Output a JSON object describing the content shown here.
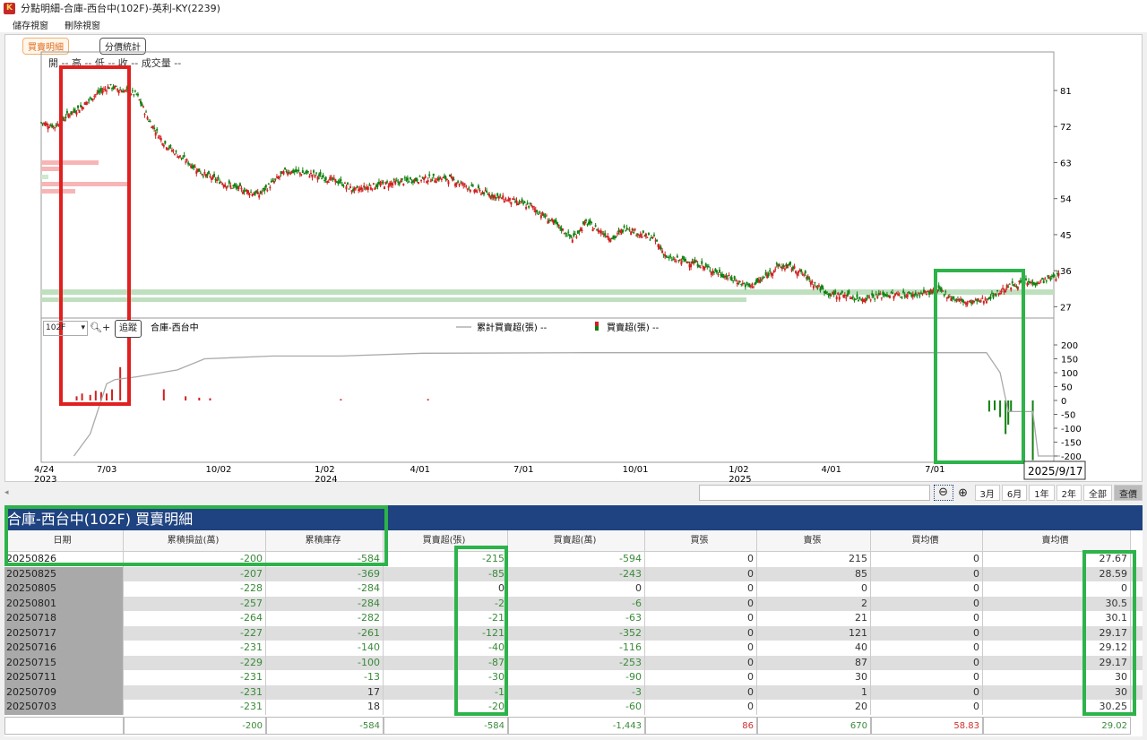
{
  "window": {
    "title": "分點明細-合庫-西台中(102F)-英利-KY(2239)",
    "app_icon": "K"
  },
  "menu": [
    "儲存視窗",
    "刪除視窗"
  ],
  "tabs": [
    "買賣明細",
    "分價統計"
  ],
  "ohlc_label": "開 -- 高 -- 低 -- 收 -- 成交量 --",
  "lower_panel": {
    "broker_select": "102F",
    "track_button": "追蹤",
    "broker_name": "合庫-西台中",
    "legend_line": "累計買賣超(張) --",
    "legend_bar": "買賣超(張) --"
  },
  "tooltip_date": "2025/9/17",
  "nav": {
    "buttons": [
      "3月",
      "6月",
      "1年",
      "2年",
      "全部",
      "查價"
    ]
  },
  "colors": {
    "up": "#d02020",
    "down": "#108010",
    "header": "#1e4380",
    "annot_red": "#e02020",
    "annot_green": "#2db34a"
  },
  "chart_data": [
    {
      "type": "candlestick",
      "title": "英利-KY(2239) 價格",
      "y_ticks": [
        81,
        72,
        63,
        54,
        45,
        36,
        27
      ],
      "ylim": [
        23,
        87
      ],
      "x_ticks": [
        {
          "label": "4/24",
          "year": "2023"
        },
        {
          "label": "7/03"
        },
        {
          "label": "10/02"
        },
        {
          "label": "1/02",
          "year": "2024"
        },
        {
          "label": "4/01"
        },
        {
          "label": "7/01"
        },
        {
          "label": "10/01"
        },
        {
          "label": "1/02",
          "year": "2025"
        },
        {
          "label": "4/01"
        },
        {
          "label": "7/01"
        }
      ],
      "close_series_month_index": [
        0,
        0.5,
        1,
        1.5,
        2,
        2.5,
        3,
        3.5,
        4,
        4.5,
        5,
        6,
        7,
        8,
        8.5,
        9,
        10,
        11,
        11.5,
        12,
        13,
        14,
        15,
        16,
        17,
        18,
        19,
        19.5,
        20,
        20.5,
        21,
        21.5,
        22,
        22.5,
        23,
        24,
        25,
        26,
        26.5,
        27,
        27.5,
        28,
        28.5,
        29,
        29.5,
        30,
        31,
        32,
        33,
        33.5,
        34,
        34.5,
        35,
        35.5,
        36,
        36.5,
        37,
        37.4
      ],
      "close": [
        73,
        72,
        75,
        77,
        80,
        82,
        81,
        80,
        73,
        68,
        65,
        60,
        57,
        55,
        58,
        61,
        60,
        58,
        56,
        57,
        58,
        59,
        59,
        56,
        54,
        52,
        47,
        44,
        48,
        46,
        44,
        47,
        45,
        44,
        39,
        38,
        35,
        32,
        34,
        37,
        37,
        35,
        32,
        30,
        30,
        29,
        30,
        30,
        31,
        29,
        28,
        28.5,
        30,
        32,
        33,
        33,
        34,
        35
      ]
    },
    {
      "type": "bar+line",
      "series": [
        {
          "name": "累計買賣超(張)",
          "type": "line"
        },
        {
          "name": "買賣超(張)",
          "type": "bar"
        }
      ],
      "y_ticks": [
        200,
        150,
        100,
        50,
        0,
        -50,
        -100,
        -150,
        -200
      ],
      "ylim": [
        -220,
        220
      ],
      "cum_month_index": [
        1.2,
        1.8,
        2.2,
        2.4,
        2.7,
        3.5,
        5,
        6,
        8.5,
        11,
        14,
        20,
        26,
        30,
        34.7,
        35.2,
        35.5,
        36.4,
        36.6,
        37.4
      ],
      "cum": [
        -200,
        -120,
        0,
        60,
        75,
        85,
        110,
        150,
        160,
        160,
        170,
        172,
        172,
        172,
        172,
        100,
        -40,
        -40,
        -200,
        -200
      ],
      "bar_month_index": [
        1.3,
        1.5,
        1.8,
        2.0,
        2.2,
        2.4,
        2.6,
        2.9,
        3.2,
        4.5,
        5.3,
        5.8,
        6.2,
        11,
        14.2,
        34.8,
        35.0,
        35.2,
        35.4,
        35.5,
        35.6,
        36.4
      ],
      "bars": [
        15,
        25,
        20,
        35,
        30,
        25,
        40,
        120,
        20,
        40,
        15,
        10,
        8,
        5,
        5,
        -40,
        -35,
        -60,
        -121,
        -87,
        -40,
        -215
      ]
    }
  ],
  "table": {
    "title": "合庫-西台中(102F) 買賣明細",
    "columns": [
      "日期",
      "累積損益(萬)",
      "累積庫存",
      "買賣超(張)",
      "買賣超(萬)",
      "買張",
      "賣張",
      "買均價",
      "賣均價"
    ],
    "rows": [
      [
        "20250826",
        "-200",
        "-584",
        "-215",
        "-594",
        "0",
        "215",
        "0",
        "27.67"
      ],
      [
        "20250825",
        "-207",
        "-369",
        "-85",
        "-243",
        "0",
        "85",
        "0",
        "28.59"
      ],
      [
        "20250805",
        "-228",
        "-284",
        "0",
        "0",
        "0",
        "0",
        "0",
        "0"
      ],
      [
        "20250801",
        "-257",
        "-284",
        "-2",
        "-6",
        "0",
        "2",
        "0",
        "30.5"
      ],
      [
        "20250718",
        "-264",
        "-282",
        "-21",
        "-63",
        "0",
        "21",
        "0",
        "30.1"
      ],
      [
        "20250717",
        "-227",
        "-261",
        "-121",
        "-352",
        "0",
        "121",
        "0",
        "29.17"
      ],
      [
        "20250716",
        "-231",
        "-140",
        "-40",
        "-116",
        "0",
        "40",
        "0",
        "29.12"
      ],
      [
        "20250715",
        "-229",
        "-100",
        "-87",
        "-253",
        "0",
        "87",
        "0",
        "29.17"
      ],
      [
        "20250711",
        "-231",
        "-13",
        "-30",
        "-90",
        "0",
        "30",
        "0",
        "30"
      ],
      [
        "20250709",
        "-231",
        "17",
        "-1",
        "-3",
        "0",
        "1",
        "0",
        "30"
      ],
      [
        "20250703",
        "-231",
        "18",
        "-20",
        "-60",
        "0",
        "20",
        "0",
        "30.25"
      ]
    ],
    "totals": [
      "",
      "-200",
      "-584",
      "-584",
      "-1,443",
      "86",
      "670",
      "58.83",
      "29.02"
    ]
  }
}
